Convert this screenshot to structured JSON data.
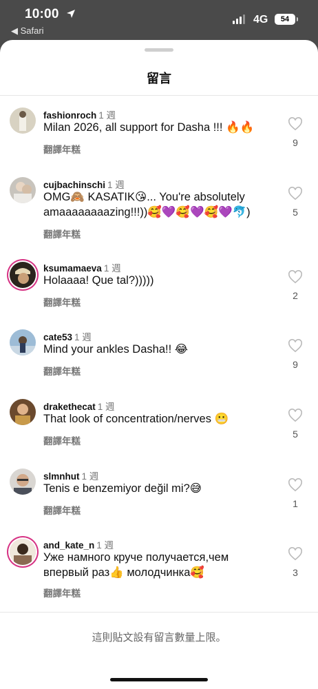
{
  "status_bar": {
    "time": "10:00",
    "back_label": "◀ Safari",
    "network": "4G",
    "battery": "54"
  },
  "sheet": {
    "title": "留言",
    "footer_note": "這則貼文設有留言數量上限。"
  },
  "comments": [
    {
      "username": "fashionroch",
      "ago": "1 週",
      "text": "Milan 2026, all support for Dasha !!! 🔥🔥",
      "translate": "翻譯年糕",
      "likes": "9",
      "avatar_color": "#c9c0a8"
    },
    {
      "username": "cujbachinschi",
      "ago": "1 週",
      "text": "OMG🙈 KASATIK😘... You're absolutely amaaaaaaaazing!!!))🥰💜🥰💜🥰💜🐬)",
      "translate": "翻譯年糕",
      "likes": "5",
      "avatar_color": "#bfb8ae"
    },
    {
      "username": "ksumamaeva",
      "ago": "1 週",
      "text": "Holaaaa! Que tal?)))))",
      "translate": "翻譯年糕",
      "likes": "2",
      "avatar_color": "#3a2f24"
    },
    {
      "username": "cate53",
      "ago": "1 週",
      "text": "Mind your ankles Dasha!! 😂",
      "translate": "翻譯年糕",
      "likes": "9",
      "avatar_color": "#7fa4c4"
    },
    {
      "username": "drakethecat",
      "ago": "1 週",
      "text": "That look of concentration/nerves 😬",
      "translate": "翻譯年糕",
      "likes": "5",
      "avatar_color": "#a8733f"
    },
    {
      "username": "slmnhut",
      "ago": "1 週",
      "text": "Tenis e benzemiyor değil mi?😅",
      "translate": "翻譯年糕",
      "likes": "1",
      "avatar_color": "#8f8a86"
    },
    {
      "username": "and_kate_n",
      "ago": "1 週",
      "text": "Уже намного круче получается,чем впервый раз👍 молодчинка🥰",
      "translate": "翻譯年糕",
      "likes": "3",
      "avatar_color": "#5a4a3c"
    }
  ]
}
